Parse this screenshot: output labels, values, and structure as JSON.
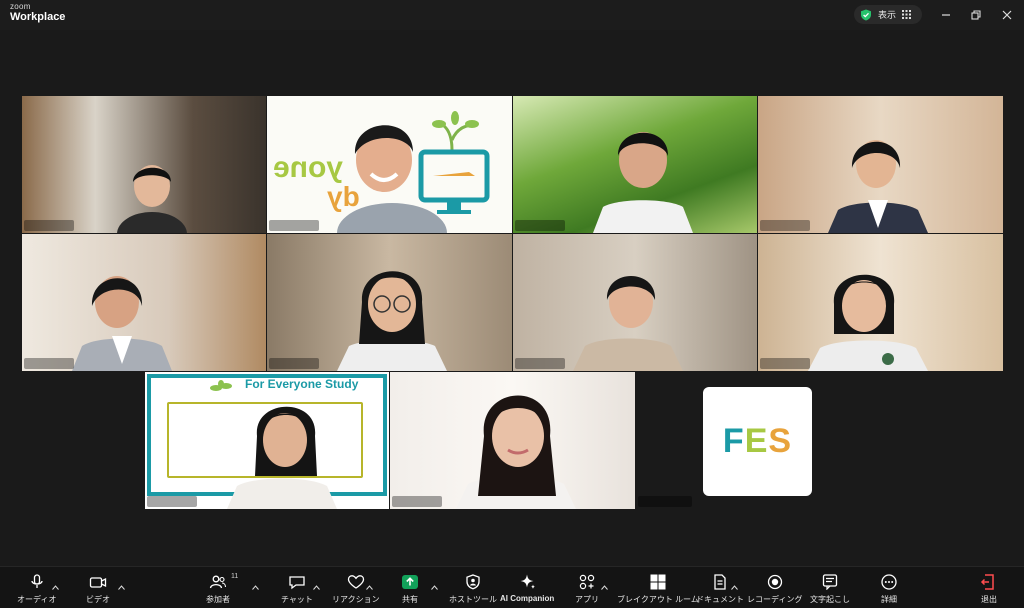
{
  "app": {
    "brand_small": "zoom",
    "brand_big": "Workplace",
    "view_label": "表示"
  },
  "colors": {
    "accent_green": "#2fd58a",
    "share_green": "#12a15a",
    "fes_f": "#1b9aa6",
    "fes_e": "#a7c843",
    "fes_s": "#e8a33c",
    "banner_teal": "#1b9aa6",
    "banner_olive": "#b7b52a"
  },
  "participants": {
    "banners": {
      "tile2_word1": "yone",
      "tile2_word2": "dy",
      "tile10_title": "For Everyone Study"
    },
    "fes_logo": {
      "f": "F",
      "e": "E",
      "s": "S"
    }
  },
  "toolbar": {
    "items": [
      {
        "label": "オーディオ",
        "icon": "microphone-icon"
      },
      {
        "label": "ビデオ",
        "icon": "video-camera-icon"
      },
      {
        "label": "参加者",
        "icon": "participants-icon",
        "count": "11"
      },
      {
        "label": "チャット",
        "icon": "chat-icon"
      },
      {
        "label": "リアクション",
        "icon": "heart-icon"
      },
      {
        "label": "共有",
        "icon": "share-screen-icon"
      },
      {
        "label": "ホストツール",
        "icon": "host-tools-shield-icon"
      },
      {
        "label": "AI Companion",
        "icon": "ai-companion-sparkle-icon"
      },
      {
        "label": "アプリ",
        "icon": "apps-icon"
      },
      {
        "label": "ブレイクアウト ルーム",
        "icon": "breakout-rooms-icon"
      },
      {
        "label": "ドキュメント",
        "icon": "document-icon"
      },
      {
        "label": "レコーディング",
        "icon": "record-icon"
      },
      {
        "label": "文字起こし",
        "icon": "transcript-icon"
      },
      {
        "label": "詳細",
        "icon": "more-icon"
      },
      {
        "label": "退出",
        "icon": "leave-door-icon"
      }
    ]
  }
}
